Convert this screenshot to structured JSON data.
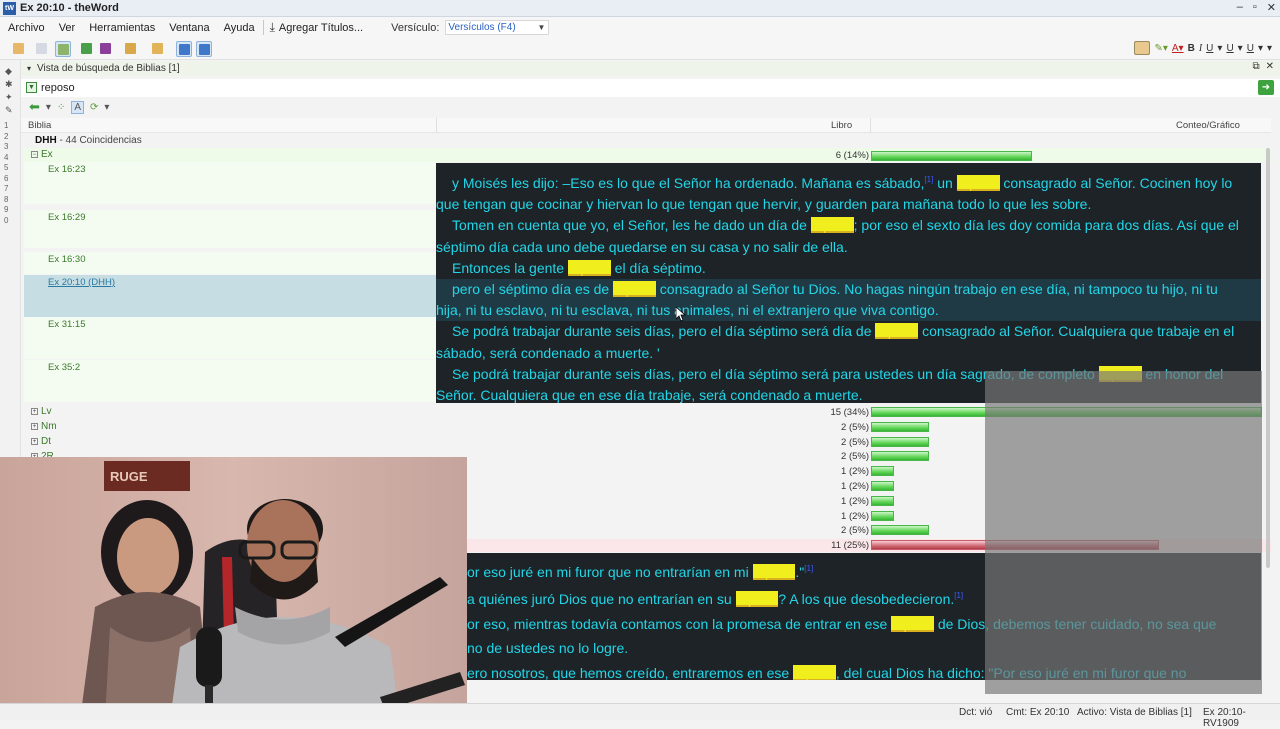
{
  "window": {
    "title": "Ex 20:10 - theWord",
    "app_icon": "tW",
    "controls": [
      "–",
      "▫",
      "✕"
    ]
  },
  "menu": {
    "items": [
      "Archivo",
      "Ver",
      "Herramientas",
      "Ventana",
      "Ayuda"
    ],
    "add_titles": "Agregar Títulos...",
    "verse_label": "Versículo:",
    "verse_select": "Versículos (F4)"
  },
  "format_toolbar": {
    "bold": "B",
    "italic": "I",
    "underline": "U"
  },
  "panel": {
    "title": "Vista de búsqueda de Biblias [1]",
    "search_value": "reposo"
  },
  "columns": {
    "bible": "Biblia",
    "book": "Libro",
    "count": "Conteo/Gráfico"
  },
  "line_numbers": [
    "1",
    "2",
    "3",
    "4",
    "5",
    "6",
    "7",
    "8",
    "9",
    "0"
  ],
  "tree": {
    "version": "DHH",
    "version_count": "- 44 Coincidencias",
    "book_ex": "Ex",
    "book_ex_count": "6 (14%)",
    "book_ex_pct": 14,
    "verses": [
      {
        "ref": "Ex 16:23"
      },
      {
        "ref": "Ex 16:29"
      },
      {
        "ref": "Ex 16:30"
      },
      {
        "ref": "Ex 20:10 (DHH)"
      },
      {
        "ref": "Ex 31:15"
      },
      {
        "ref": "Ex 35:2"
      }
    ],
    "books": [
      {
        "name": "Lv",
        "count": "15 (34%)",
        "pct": 34
      },
      {
        "name": "Nm",
        "count": "2 (5%)",
        "pct": 5
      },
      {
        "name": "Dt",
        "count": "2 (5%)",
        "pct": 5
      },
      {
        "name": "2R",
        "count": "2 (5%)",
        "pct": 5
      }
    ],
    "hidden_counts": [
      {
        "count": "1 (2%)",
        "pct": 2
      },
      {
        "count": "1 (2%)",
        "pct": 2
      },
      {
        "count": "1 (2%)",
        "pct": 2
      },
      {
        "count": "1 (2%)",
        "pct": 2
      },
      {
        "count": "2 (5%)",
        "pct": 5
      },
      {
        "count": "11 (25%)",
        "pct": 25
      }
    ]
  },
  "preview": {
    "keyword": "reposo",
    "v1_a": "y Moisés les dijo: –Eso es lo que el Señor ha ordenado. Mañana es sábado,",
    "v1_note": "[1]",
    "v1_b": " un ",
    "v1_c": " consagrado al Señor. Cocinen hoy lo que tengan que cocinar y hiervan lo que tengan que hervir, y guarden para mañana todo lo que les sobre.",
    "v2_a": "Tomen en cuenta que yo, el Señor, les he dado un día de ",
    "v2_b": "; por eso el sexto día les doy comida para dos días. Así que el séptimo día cada uno debe quedarse en su casa y no salir de ella.",
    "v3_a": "Entonces la gente ",
    "v3_b": " el día séptimo.",
    "v4_a": "pero el séptimo día es de ",
    "v4_b": " consagrado al Señor tu Dios. No hagas ningún trabajo en ese día, ni tampoco tu hijo, ni tu hija, ni tu esclavo, ni tu esclava, ni tus animales, ni el extranjero que viva contigo.",
    "v5_a": "Se podrá trabajar durante seis días, pero el día séptimo será día de ",
    "v5_b": " consagrado al Señor. Cualquiera que trabaje en el sábado, será condenado a muerte. '",
    "v6_a": "Se podrá trabajar durante seis días, pero el día séptimo será para ustedes un día sagrado, de completo ",
    "v6_b": " en honor del Señor. Cualquiera que en ese día trabaje, será condenado a muerte."
  },
  "preview2": {
    "l1_a": "or eso juré en mi furor que no entrarían en mi ",
    "l1_b": ".\"",
    "l1_note": "[1]",
    "l2_a": " a quiénes juró Dios que no entrarían en su ",
    "l2_b": "? A los que desobedecieron.",
    "l2_note": "[1]",
    "l3_a": "or eso, mientras todavía contamos con la promesa de entrar en ese ",
    "l3_b": " de Dios, debemos tener cuidado, no sea que",
    "l4": "no de ustedes no lo logre.",
    "l5_a": "ero nosotros, que hemos creído, entraremos en ese ",
    "l5_b": ", del cual Dios ha dicho: \"Por eso juré en mi furor que no"
  },
  "webcam": {
    "sign_text": "RUGE"
  },
  "status": {
    "s1": "Dct: vió",
    "s2": "Cmt: Ex 20:10",
    "s3": "Activo: Vista de Biblias [1]",
    "s4": "Ex 20:10-RV1909"
  },
  "colors": {
    "preview_bg": "#1d2326",
    "preview_text": "#22d6e8",
    "highlight": "#f0ee1c",
    "bar_green": "#4cc64a",
    "bar_red": "#b23a48"
  }
}
